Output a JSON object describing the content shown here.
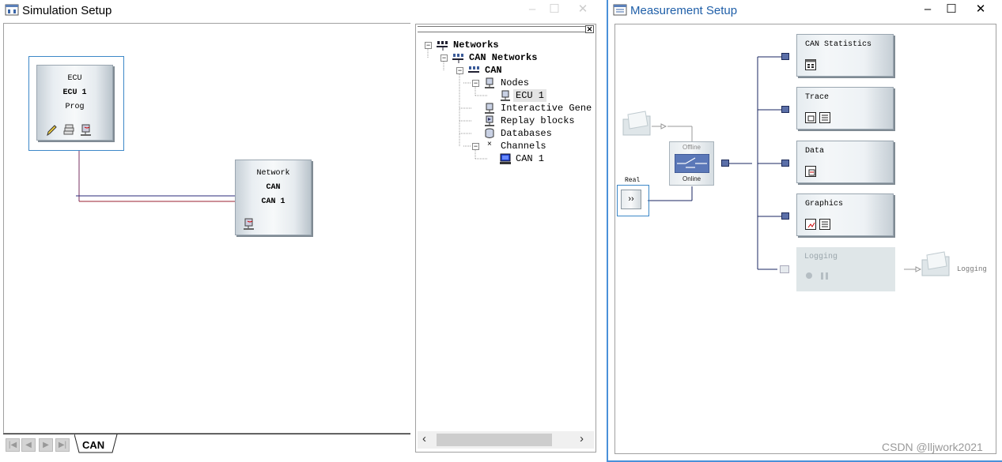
{
  "simulation_window": {
    "title": "Simulation Setup",
    "ecu_node": {
      "type": "ECU",
      "name": "ECU 1",
      "status": "Prog"
    },
    "network_node": {
      "type": "Network",
      "protocol": "CAN",
      "channel": "CAN 1"
    },
    "tab": "CAN"
  },
  "tree": {
    "root": "Networks",
    "can_networks": "CAN Networks",
    "can": "CAN",
    "nodes": "Nodes",
    "ecu1": "ECU 1",
    "interactive": "Interactive Gene",
    "replay": "Replay blocks",
    "databases": "Databases",
    "channels": "Channels",
    "can1": "CAN 1"
  },
  "measurement_window": {
    "title": "Measurement Setup",
    "offline": "Offline",
    "online": "Online",
    "real": "Real",
    "blocks": [
      "CAN Statistics",
      "Trace",
      "Data",
      "Graphics",
      "Logging"
    ],
    "logging_file": "Logging"
  },
  "watermark": "CSDN @lljwork2021"
}
